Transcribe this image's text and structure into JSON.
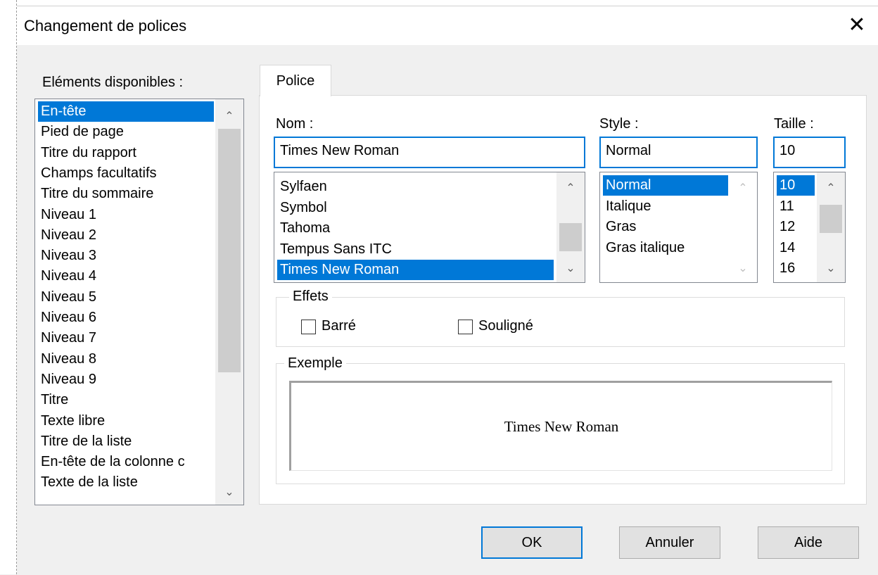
{
  "window": {
    "title": "Changement de polices",
    "close_glyph": "✕"
  },
  "elements": {
    "label": "Eléments disponibles :",
    "items": [
      "En-tête",
      "Pied de page",
      "Titre du rapport",
      "Champs facultatifs",
      "Titre du sommaire",
      "Niveau 1",
      "Niveau 2",
      "Niveau 3",
      "Niveau 4",
      "Niveau 5",
      "Niveau 6",
      "Niveau 7",
      "Niveau 8",
      "Niveau 9",
      "Titre",
      "Texte libre",
      "Titre de la liste",
      "En-tête de la colonne c",
      "Texte de la liste"
    ],
    "selected_index": 0
  },
  "tab": {
    "label": "Police"
  },
  "font_name": {
    "label": "Nom :",
    "value": "Times New Roman",
    "items": [
      "Sylfaen",
      "Symbol",
      "Tahoma",
      "Tempus Sans ITC",
      "Times New Roman"
    ],
    "selected_index": 4
  },
  "font_style": {
    "label": "Style :",
    "value": "Normal",
    "items": [
      "Normal",
      "Italique",
      "Gras",
      "Gras italique"
    ],
    "selected_index": 0
  },
  "font_size": {
    "label": "Taille :",
    "value": "10",
    "items": [
      "10",
      "11",
      "12",
      "14",
      "16"
    ],
    "selected_index": 0
  },
  "effects": {
    "title": "Effets",
    "strike_label": "Barré",
    "underline_label": "Souligné",
    "strike_checked": false,
    "underline_checked": false
  },
  "sample": {
    "title": "Exemple",
    "text": "Times New Roman"
  },
  "buttons": {
    "ok": "OK",
    "cancel": "Annuler",
    "help": "Aide"
  },
  "icons": {
    "scroll_up": "chevron-up-icon",
    "scroll_down": "chevron-down-icon",
    "close": "close-icon"
  },
  "colors": {
    "selection": "#0078d7",
    "focus_border": "#0078d7",
    "dialog_bg": "#f0f0f0"
  }
}
